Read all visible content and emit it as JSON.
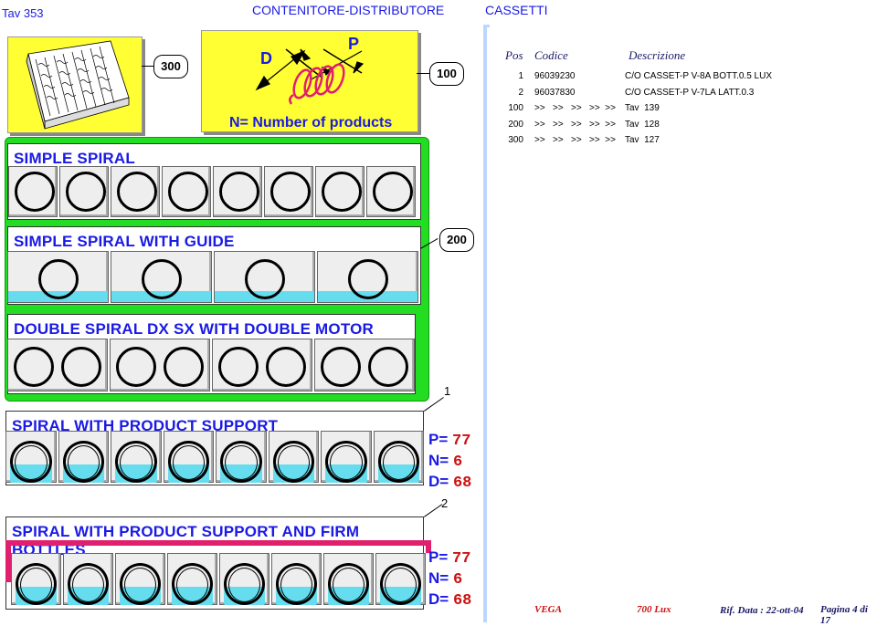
{
  "header": {
    "tav": "Tav 353",
    "title": "CONTENITORE-DISTRIBUTORE",
    "section": "CASSETTI"
  },
  "callouts": {
    "c300": "300",
    "c100": "100",
    "c200": "200",
    "c1": "1",
    "c2": "2"
  },
  "legend_box": {
    "d": "D",
    "p": "P",
    "caption": "N= Number of products"
  },
  "sections": {
    "simple_spiral": "SIMPLE SPIRAL",
    "simple_spiral_guide": "SIMPLE SPIRAL WITH GUIDE",
    "double_spiral": "DOUBLE SPIRAL DX SX WITH DOUBLE MOTOR",
    "product_support": "SPIRAL WITH PRODUCT SUPPORT",
    "firm_bottles": "SPIRAL WITH PRODUCT SUPPORT AND FIRM BOTTLES"
  },
  "params_1": {
    "p_label": "P=",
    "p_value": "77",
    "n_label": "N=",
    "n_value": "6",
    "d_label": "D=",
    "d_value": "68"
  },
  "params_2": {
    "p_label": "P=",
    "p_value": "77",
    "n_label": "N=",
    "n_value": "6",
    "d_label": "D=",
    "d_value": "68"
  },
  "table": {
    "headers": {
      "pos": "Pos",
      "codice": "Codice",
      "descrizione": "Descrizione"
    },
    "rows": [
      {
        "pos": "1",
        "codice": "96039230",
        "descrizione": "C/O CASSET-P V-8A BOTT.0.5 LUX"
      },
      {
        "pos": "2",
        "codice": "96037830",
        "descrizione": "C/O CASSET-P V-7LA LATT.0.3"
      },
      {
        "pos": "100",
        "codice": ">>   >>   >>   >>  >>",
        "descrizione": "Tav  139"
      },
      {
        "pos": "200",
        "codice": ">>   >>   >>   >>  >>",
        "descrizione": "Tav  128"
      },
      {
        "pos": "300",
        "codice": ">>   >>   >>   >>  >>",
        "descrizione": "Tav  127"
      }
    ]
  },
  "footer": {
    "vega": "VEGA",
    "model": "700 Lux",
    "rif": "Rif. Data : 22-ott-04",
    "page": "Pagina 4 di 17"
  },
  "colors": {
    "accent_blue": "#1a1ae6",
    "green": "#22dd22",
    "yellow": "#ffff33",
    "water": "#66ddee",
    "magenta": "#e0206e",
    "red": "#cc1111"
  }
}
